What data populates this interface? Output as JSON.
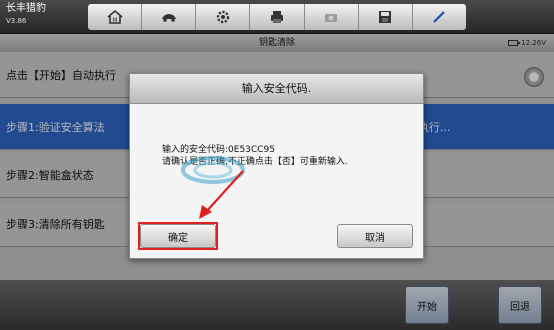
{
  "header": {
    "brand": "长丰猎豹",
    "version": "V3.86",
    "tools": [
      "home-icon",
      "car-icon",
      "gear-icon",
      "printer-icon",
      "camera-icon",
      "save-icon",
      "pen-icon"
    ]
  },
  "titlebar": {
    "title": "钥匙清除",
    "battery": "12.26V"
  },
  "steps": [
    {
      "label": "点击【开始】自动执行"
    },
    {
      "label": "步骤1:验证安全算法",
      "status": "执行..."
    },
    {
      "label": "步骤2:智能盒状态"
    },
    {
      "label": "步骤3:清除所有钥匙"
    }
  ],
  "bottom": {
    "start": "开始",
    "back": "回退"
  },
  "dialog": {
    "title": "输入安全代码.",
    "line1": "输入的安全代码:0E53CC95",
    "line2": "请确认是否正确,不正确点击【否】可重新输入.",
    "ok": "确定",
    "cancel": "取消"
  },
  "colors": {
    "selected_row": "#2f67c9",
    "highlight": "#e02020"
  }
}
